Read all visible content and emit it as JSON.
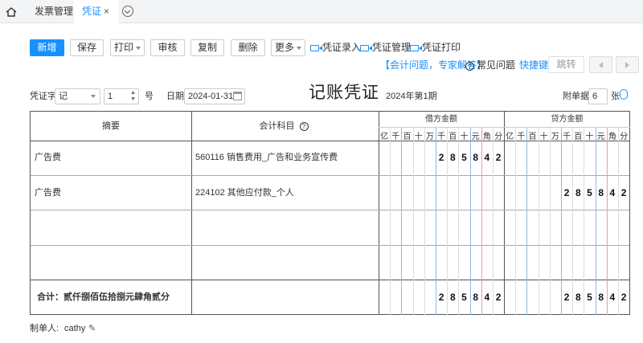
{
  "tabs": {
    "home_icon": "home-icon",
    "items": [
      {
        "label": "发票管理"
      },
      {
        "label": "凭证",
        "close": "×"
      }
    ]
  },
  "toolbar": {
    "new": "新增",
    "save": "保存",
    "print": "打印",
    "audit": "审核",
    "copy": "复制",
    "delete": "删除",
    "more": "更多",
    "links": [
      "凭证录入",
      "凭证管理",
      "凭证打印"
    ],
    "expert": "【会计问题，专家解答】",
    "faq": "常见问题",
    "shortcut": "快捷键",
    "jump": "跳转"
  },
  "header": {
    "voucher_word_label": "凭证字",
    "voucher_word": "记",
    "number": "1",
    "number_suffix": "号",
    "date_label": "日期",
    "date": "2024-01-31",
    "title": "记账凭证",
    "period": "2024年第1期",
    "attach_label": "附单据",
    "attach_count": "6",
    "attach_suffix": "张"
  },
  "table": {
    "col_summary": "摘要",
    "col_account": "会计科目",
    "debit": "借方金额",
    "credit": "贷方金额",
    "units": [
      "亿",
      "千",
      "百",
      "十",
      "万",
      "千",
      "百",
      "十",
      "元",
      "角",
      "分"
    ],
    "rows": [
      {
        "summary": "广告费",
        "account": "560116 销售费用_广告和业务宣传费",
        "debit": "285842",
        "credit": ""
      },
      {
        "summary": "广告费",
        "account": "224102 其他应付款_个人",
        "debit": "",
        "credit": "285842"
      },
      {
        "summary": "",
        "account": "",
        "debit": "",
        "credit": ""
      },
      {
        "summary": "",
        "account": "",
        "debit": "",
        "credit": ""
      }
    ],
    "total_label": "合计：贰仟捌佰伍拾捌元肆角贰分",
    "total_debit": "285842",
    "total_credit": "285842"
  },
  "footer": {
    "maker_label": "制单人:",
    "maker": "cathy"
  },
  "colors": {
    "accent": "#1890ff"
  }
}
